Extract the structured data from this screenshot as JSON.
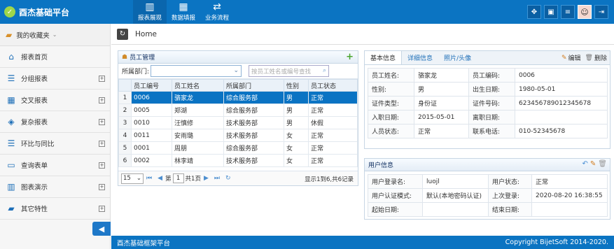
{
  "app": {
    "title": "酉杰基础平台"
  },
  "topnav": [
    {
      "label": "报表展现",
      "icon": "bar-chart-icon"
    },
    {
      "label": "数据填报",
      "icon": "table-icon"
    },
    {
      "label": "业务流程",
      "icon": "shuffle-icon"
    }
  ],
  "sidebar": {
    "favorites": "我的收藏夹",
    "items": [
      {
        "label": "报表首页",
        "icon": "home-icon",
        "expandable": false
      },
      {
        "label": "分组报表",
        "icon": "group-list-icon",
        "expandable": true
      },
      {
        "label": "交叉报表",
        "icon": "grid-icon",
        "expandable": true
      },
      {
        "label": "复杂报表",
        "icon": "cube-icon",
        "expandable": true
      },
      {
        "label": "环比与同比",
        "icon": "list-icon",
        "expandable": true
      },
      {
        "label": "查询表单",
        "icon": "form-icon",
        "expandable": true
      },
      {
        "label": "图表演示",
        "icon": "bar-chart-icon",
        "expandable": true
      },
      {
        "label": "其它特性",
        "icon": "folder-icon",
        "expandable": true
      }
    ]
  },
  "breadcrumb": {
    "home": "Home"
  },
  "employee_panel": {
    "title": "员工管理",
    "dept_label": "所属部门:",
    "search_placeholder": "按员工姓名或编号查找",
    "columns": [
      "员工编号",
      "员工姓名",
      "所属部门",
      "性别",
      "员工状态"
    ],
    "rows": [
      {
        "n": "1",
        "id": "0006",
        "name": "骆家龙",
        "dept": "综合服务部",
        "sex": "男",
        "status": "正常",
        "selected": true
      },
      {
        "n": "2",
        "id": "0005",
        "name": "郑湖",
        "dept": "综合服务部",
        "sex": "男",
        "status": "正常",
        "selected": false
      },
      {
        "n": "3",
        "id": "0010",
        "name": "汪慎修",
        "dept": "技术服务部",
        "sex": "男",
        "status": "休假",
        "selected": false
      },
      {
        "n": "4",
        "id": "0011",
        "name": "安雨璐",
        "dept": "技术服务部",
        "sex": "女",
        "status": "正常",
        "selected": false
      },
      {
        "n": "5",
        "id": "0001",
        "name": "周朋",
        "dept": "综合服务部",
        "sex": "女",
        "status": "正常",
        "selected": false
      },
      {
        "n": "6",
        "id": "0002",
        "name": "林李靖",
        "dept": "技术服务部",
        "sex": "女",
        "status": "正常",
        "selected": false
      }
    ],
    "pager": {
      "page_size": "15",
      "page_prefix": "第",
      "page": "1",
      "page_suffix": "共1页",
      "info": "显示1到6,共6记录"
    }
  },
  "detail_panel": {
    "tabs": [
      "基本信息",
      "详细信息",
      "照片/头像"
    ],
    "edit": "编辑",
    "delete": "删除",
    "rows": [
      [
        "员工姓名:",
        "骆家龙",
        "员工编码:",
        "0006"
      ],
      [
        "性别:",
        "男",
        "出生日期:",
        "1980-05-01"
      ],
      [
        "证件类型:",
        "身份证",
        "证件号码:",
        "623456789012345678"
      ],
      [
        "入职日期:",
        "2015-05-01",
        "离职日期:",
        ""
      ],
      [
        "人员状态:",
        "正常",
        "联系电话:",
        "010-52345678"
      ]
    ]
  },
  "user_panel": {
    "title": "用户信息",
    "rows": [
      [
        "用户登录名:",
        "luojl",
        "用户状态:",
        "正常"
      ],
      [
        "用户认证模式:",
        "默认(本地密码认证)",
        "上次登录:",
        "2020-08-20 16:38:55"
      ],
      [
        "起始日期:",
        "",
        "结束日期:",
        ""
      ]
    ]
  },
  "footer": {
    "left": "酉杰基础框架平台",
    "right": "Copyright BijetSoft 2014-2020."
  }
}
